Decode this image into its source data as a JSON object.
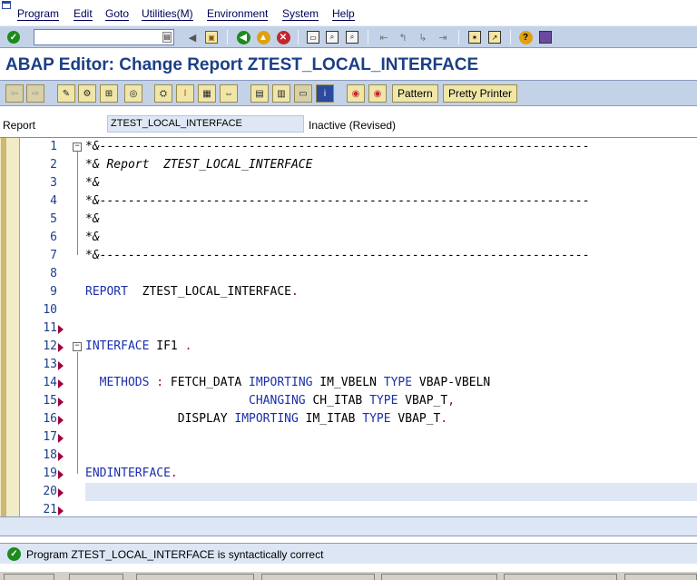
{
  "menu": [
    "Program",
    "Edit",
    "Goto",
    "Utilities(M)",
    "Environment",
    "System",
    "Help"
  ],
  "command_field": {
    "value": "",
    "placeholder": ""
  },
  "title": "ABAP Editor: Change Report ZTEST_LOCAL_INTERFACE",
  "app_toolbar": {
    "pattern_label": "Pattern",
    "pretty_printer_label": "Pretty Printer"
  },
  "report": {
    "label": "Report",
    "value": "ZTEST_LOCAL_INTERFACE",
    "status": "Inactive (Revised)"
  },
  "editor": {
    "lines": [
      {
        "num": "1",
        "text": "*&---------------------------------------------------------------------"
      },
      {
        "num": "2",
        "text": "*& Report  ZTEST_LOCAL_INTERFACE"
      },
      {
        "num": "3",
        "text": "*&"
      },
      {
        "num": "4",
        "text": "*&---------------------------------------------------------------------"
      },
      {
        "num": "5",
        "text": "*&"
      },
      {
        "num": "6",
        "text": "*&"
      },
      {
        "num": "7",
        "text": "*&---------------------------------------------------------------------"
      },
      {
        "num": "8",
        "text": ""
      },
      {
        "num": "9",
        "text": "REPORT  ZTEST_LOCAL_INTERFACE."
      },
      {
        "num": "10",
        "text": ""
      },
      {
        "num": "11",
        "text": ""
      },
      {
        "num": "12",
        "text": "INTERFACE IF1 ."
      },
      {
        "num": "13",
        "text": ""
      },
      {
        "num": "14",
        "text": "  METHODS : FETCH_DATA IMPORTING IM_VBELN TYPE VBAP-VBELN"
      },
      {
        "num": "15",
        "text": "                       CHANGING CH_ITAB TYPE VBAP_T,"
      },
      {
        "num": "16",
        "text": "             DISPLAY IMPORTING IM_ITAB TYPE VBAP_T."
      },
      {
        "num": "17",
        "text": ""
      },
      {
        "num": "18",
        "text": ""
      },
      {
        "num": "19",
        "text": "ENDINTERFACE."
      },
      {
        "num": "20",
        "text": ""
      },
      {
        "num": "21",
        "text": ""
      }
    ]
  },
  "status_message": "Program ZTEST_LOCAL_INTERFACE is syntactically correct",
  "icons": {
    "ok": "enter-check-icon",
    "save": "save-icon",
    "back": "back-icon",
    "exit": "exit-icon",
    "cancel": "cancel-icon"
  },
  "colors": {
    "title": "#1b3f86",
    "toolbar_bg": "#c4d2e8",
    "keyword": "#1a2faa",
    "comment": "#7a7a7a"
  }
}
